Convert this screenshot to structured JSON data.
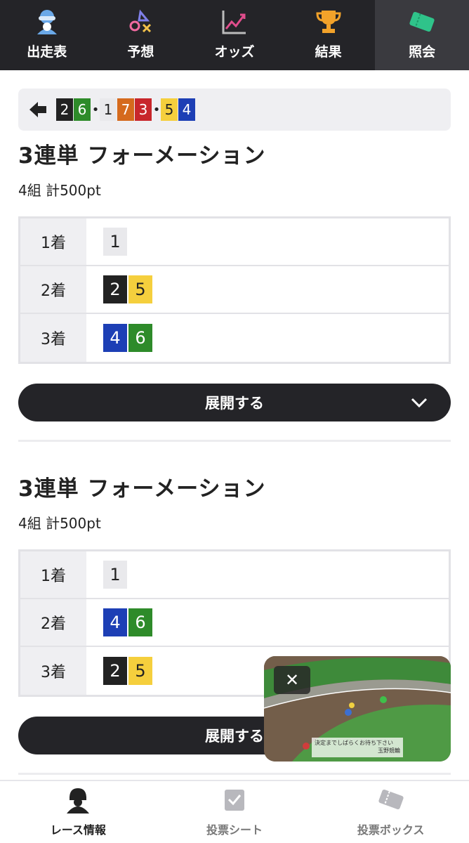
{
  "top_nav": {
    "tabs": [
      {
        "label": "出走表",
        "icon": "rider-icon"
      },
      {
        "label": "予想",
        "icon": "prediction-icon"
      },
      {
        "label": "オッズ",
        "icon": "odds-chart-icon"
      },
      {
        "label": "結果",
        "icon": "trophy-icon"
      },
      {
        "label": "照会",
        "icon": "ticket-icon",
        "active": true
      }
    ]
  },
  "breadcrumb": {
    "groups": [
      {
        "nums": [
          "2",
          "6"
        ],
        "colors": [
          "black",
          "green"
        ]
      },
      {
        "nums": [
          "1",
          "7",
          "3"
        ],
        "colors": [
          "white",
          "orange",
          "red"
        ]
      },
      {
        "nums": [
          "5",
          "4"
        ],
        "colors": [
          "yellow",
          "blue"
        ]
      }
    ],
    "separator": "•"
  },
  "sections": [
    {
      "title": "3連単 フォーメーション",
      "subtitle": "4組 計500pt",
      "rows": [
        {
          "label": "1着",
          "nums": [
            "1"
          ],
          "colors": [
            "white"
          ]
        },
        {
          "label": "2着",
          "nums": [
            "2",
            "5"
          ],
          "colors": [
            "black",
            "yellow"
          ]
        },
        {
          "label": "3着",
          "nums": [
            "4",
            "6"
          ],
          "colors": [
            "blue",
            "green"
          ]
        }
      ],
      "expand_label": "展開する"
    },
    {
      "title": "3連単 フォーメーション",
      "subtitle": "4組 計500pt",
      "rows": [
        {
          "label": "1着",
          "nums": [
            "1"
          ],
          "colors": [
            "white"
          ]
        },
        {
          "label": "2着",
          "nums": [
            "4",
            "6"
          ],
          "colors": [
            "blue",
            "green"
          ]
        },
        {
          "label": "3着",
          "nums": [
            "2",
            "5"
          ],
          "colors": [
            "black",
            "yellow"
          ]
        }
      ],
      "expand_label": "展開する"
    }
  ],
  "video": {
    "close_label": "✕",
    "caption_line1": "決定までしばらくお待ち下さい",
    "caption_line2": "玉野競輪"
  },
  "bottom_nav": {
    "items": [
      {
        "label": "レース情報",
        "icon": "helmet-icon",
        "active": true
      },
      {
        "label": "投票シート",
        "icon": "check-sheet-icon"
      },
      {
        "label": "投票ボックス",
        "icon": "ticket-box-icon"
      }
    ]
  },
  "colors": {
    "nav_bg": "#242428",
    "black": "#222222",
    "white": "#e9e9ec",
    "red": "#c8262b",
    "blue": "#1d3fb5",
    "yellow": "#f5cf3d",
    "green": "#2e8b2a",
    "orange": "#d56a1d"
  }
}
